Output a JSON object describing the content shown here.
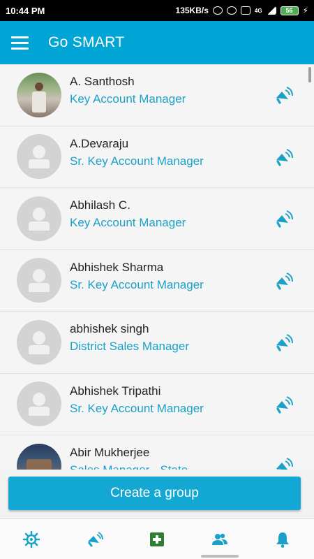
{
  "status_bar": {
    "time": "10:44 PM",
    "network_speed": "135KB/s",
    "network_type": "4G",
    "battery": "56"
  },
  "app_bar": {
    "menu_icon": "hamburger-menu-icon",
    "title": "Go SMART"
  },
  "contacts": [
    {
      "name": "A. Santhosh",
      "role": "Key Account Manager",
      "avatar": "photo"
    },
    {
      "name": "A.Devaraju",
      "role": "Sr. Key Account Manager",
      "avatar": "placeholder"
    },
    {
      "name": "Abhilash C.",
      "role": "Key Account Manager",
      "avatar": "placeholder"
    },
    {
      "name": "Abhishek Sharma",
      "role": "Sr. Key Account Manager",
      "avatar": "placeholder"
    },
    {
      "name": "abhishek singh",
      "role": "District Sales Manager",
      "avatar": "placeholder"
    },
    {
      "name": "Abhishek Tripathi",
      "role": "Sr. Key Account Manager",
      "avatar": "placeholder"
    },
    {
      "name": "Abir Mukherjee",
      "role": "Sales Manager - State",
      "avatar": "photo"
    }
  ],
  "create_group_label": "Create a group",
  "bottom_nav": [
    {
      "icon": "settings-wheel-icon"
    },
    {
      "icon": "megaphone-icon"
    },
    {
      "icon": "add-square-icon"
    },
    {
      "icon": "contacts-icon"
    },
    {
      "icon": "bell-icon"
    }
  ],
  "colors": {
    "accent": "#00a5d6",
    "role_text": "#1aa1c8",
    "nav_icon": "#1aa1c8",
    "add_icon": "#2e7d32"
  }
}
